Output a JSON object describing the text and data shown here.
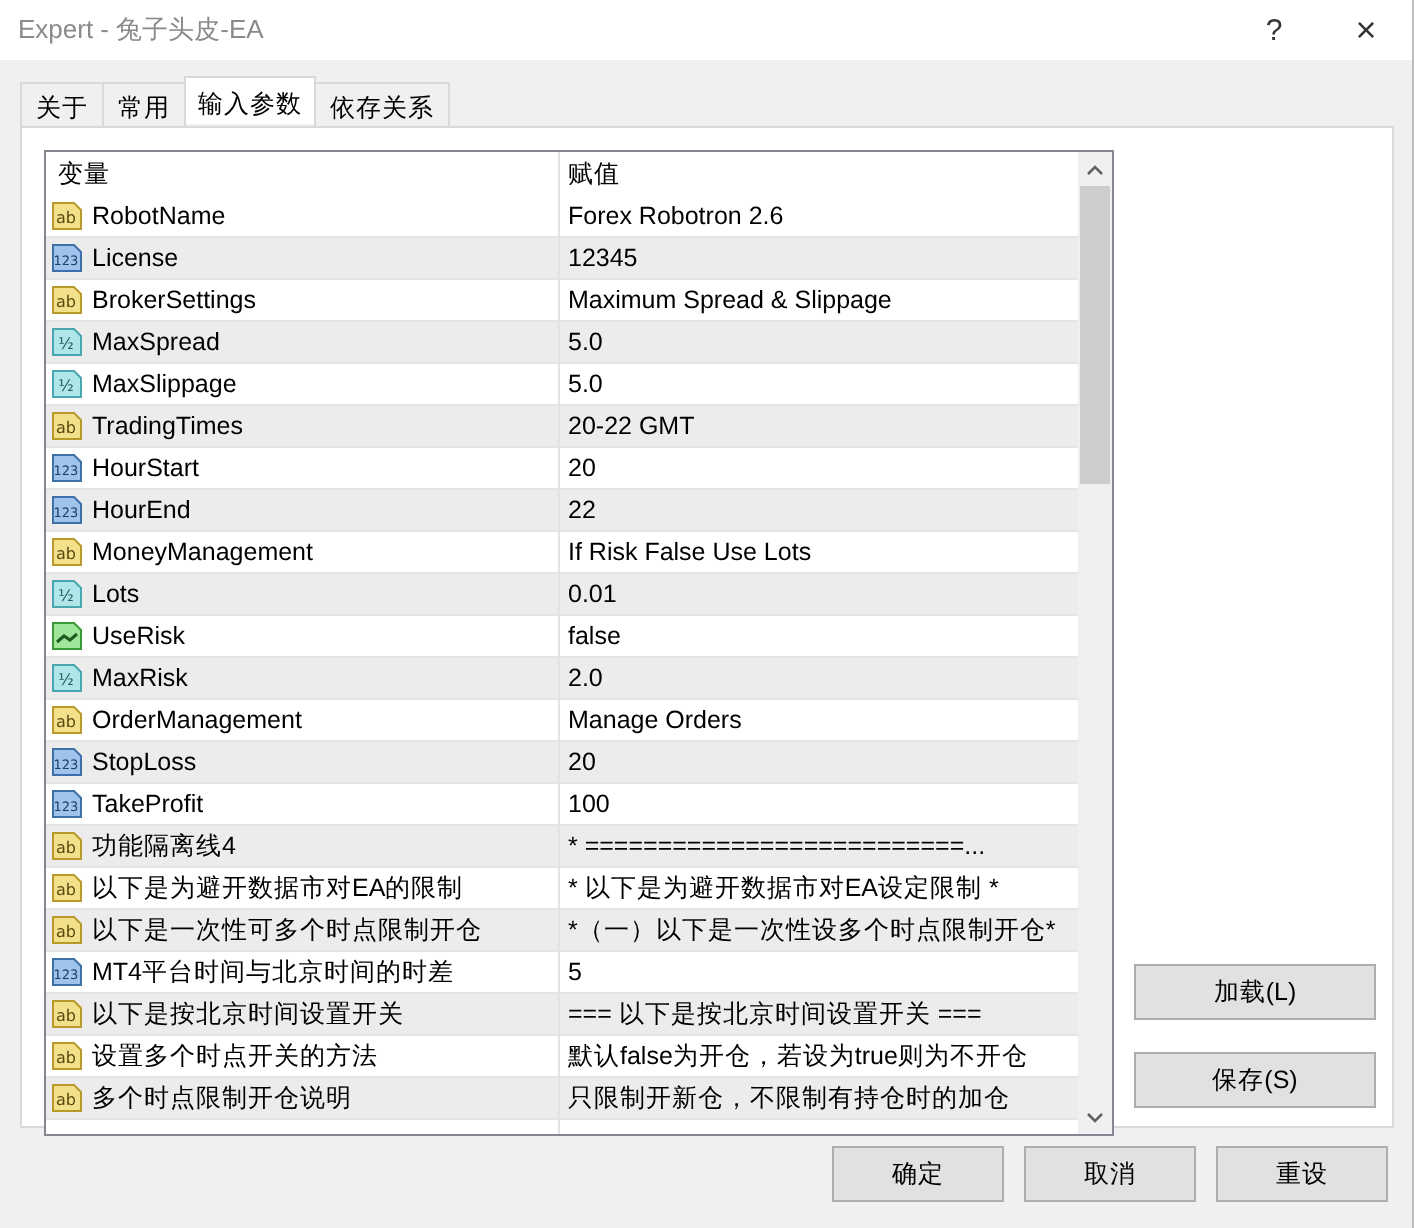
{
  "window": {
    "title": "Expert - 兔子头皮-EA",
    "help": "?",
    "close": "×"
  },
  "tabs": [
    {
      "label": "关于",
      "selected": false
    },
    {
      "label": "常用",
      "selected": false
    },
    {
      "label": "输入参数",
      "selected": true
    },
    {
      "label": "依存关系",
      "selected": false
    }
  ],
  "table": {
    "columns": [
      "变量",
      "赋值"
    ],
    "rows": [
      {
        "kind": "string",
        "icon": "ab",
        "name": "RobotName",
        "value": "Forex Robotron 2.6"
      },
      {
        "kind": "int",
        "icon": "123",
        "name": "License",
        "value": "12345"
      },
      {
        "kind": "string",
        "icon": "ab",
        "name": "BrokerSettings",
        "value": "Maximum Spread & Slippage"
      },
      {
        "kind": "double",
        "icon": "½",
        "name": "MaxSpread",
        "value": "5.0"
      },
      {
        "kind": "double",
        "icon": "½",
        "name": "MaxSlippage",
        "value": "5.0"
      },
      {
        "kind": "string",
        "icon": "ab",
        "name": "TradingTimes",
        "value": "20-22 GMT"
      },
      {
        "kind": "int",
        "icon": "123",
        "name": "HourStart",
        "value": "20"
      },
      {
        "kind": "int",
        "icon": "123",
        "name": "HourEnd",
        "value": "22"
      },
      {
        "kind": "string",
        "icon": "ab",
        "name": "MoneyManagement",
        "value": "If Risk False Use Lots"
      },
      {
        "kind": "double",
        "icon": "½",
        "name": "Lots",
        "value": "0.01"
      },
      {
        "kind": "bool",
        "name": "UseRisk",
        "value": "false"
      },
      {
        "kind": "double",
        "icon": "½",
        "name": "MaxRisk",
        "value": "2.0"
      },
      {
        "kind": "string",
        "icon": "ab",
        "name": "OrderManagement",
        "value": "Manage Orders"
      },
      {
        "kind": "int",
        "icon": "123",
        "name": "StopLoss",
        "value": "20"
      },
      {
        "kind": "int",
        "icon": "123",
        "name": "TakeProfit",
        "value": "100"
      },
      {
        "kind": "string",
        "icon": "ab",
        "name": "功能隔离线4",
        "value": "* ==========================..."
      },
      {
        "kind": "string",
        "icon": "ab",
        "name": "以下是为避开数据市对EA的限制",
        "value": "* 以下是为避开数据市对EA设定限制 *"
      },
      {
        "kind": "string",
        "icon": "ab",
        "name": "以下是一次性可多个时点限制开仓",
        "value": "*（一）以下是一次性设多个时点限制开仓*"
      },
      {
        "kind": "int",
        "icon": "123",
        "name": "MT4平台时间与北京时间的时差",
        "value": "5"
      },
      {
        "kind": "string",
        "icon": "ab",
        "name": "以下是按北京时间设置开关",
        "value": "=== 以下是按北京时间设置开关 ==="
      },
      {
        "kind": "string",
        "icon": "ab",
        "name": "设置多个时点开关的方法",
        "value": "默认false为开仓，若设为true则为不开仓"
      },
      {
        "kind": "string",
        "icon": "ab",
        "name": "多个时点限制开仓说明",
        "value": "只限制开新仓，不限制有持仓时的加仓"
      }
    ]
  },
  "side_buttons": [
    "加载(L)",
    "保存(S)"
  ],
  "buttons": [
    "确定",
    "取消",
    "重设"
  ]
}
